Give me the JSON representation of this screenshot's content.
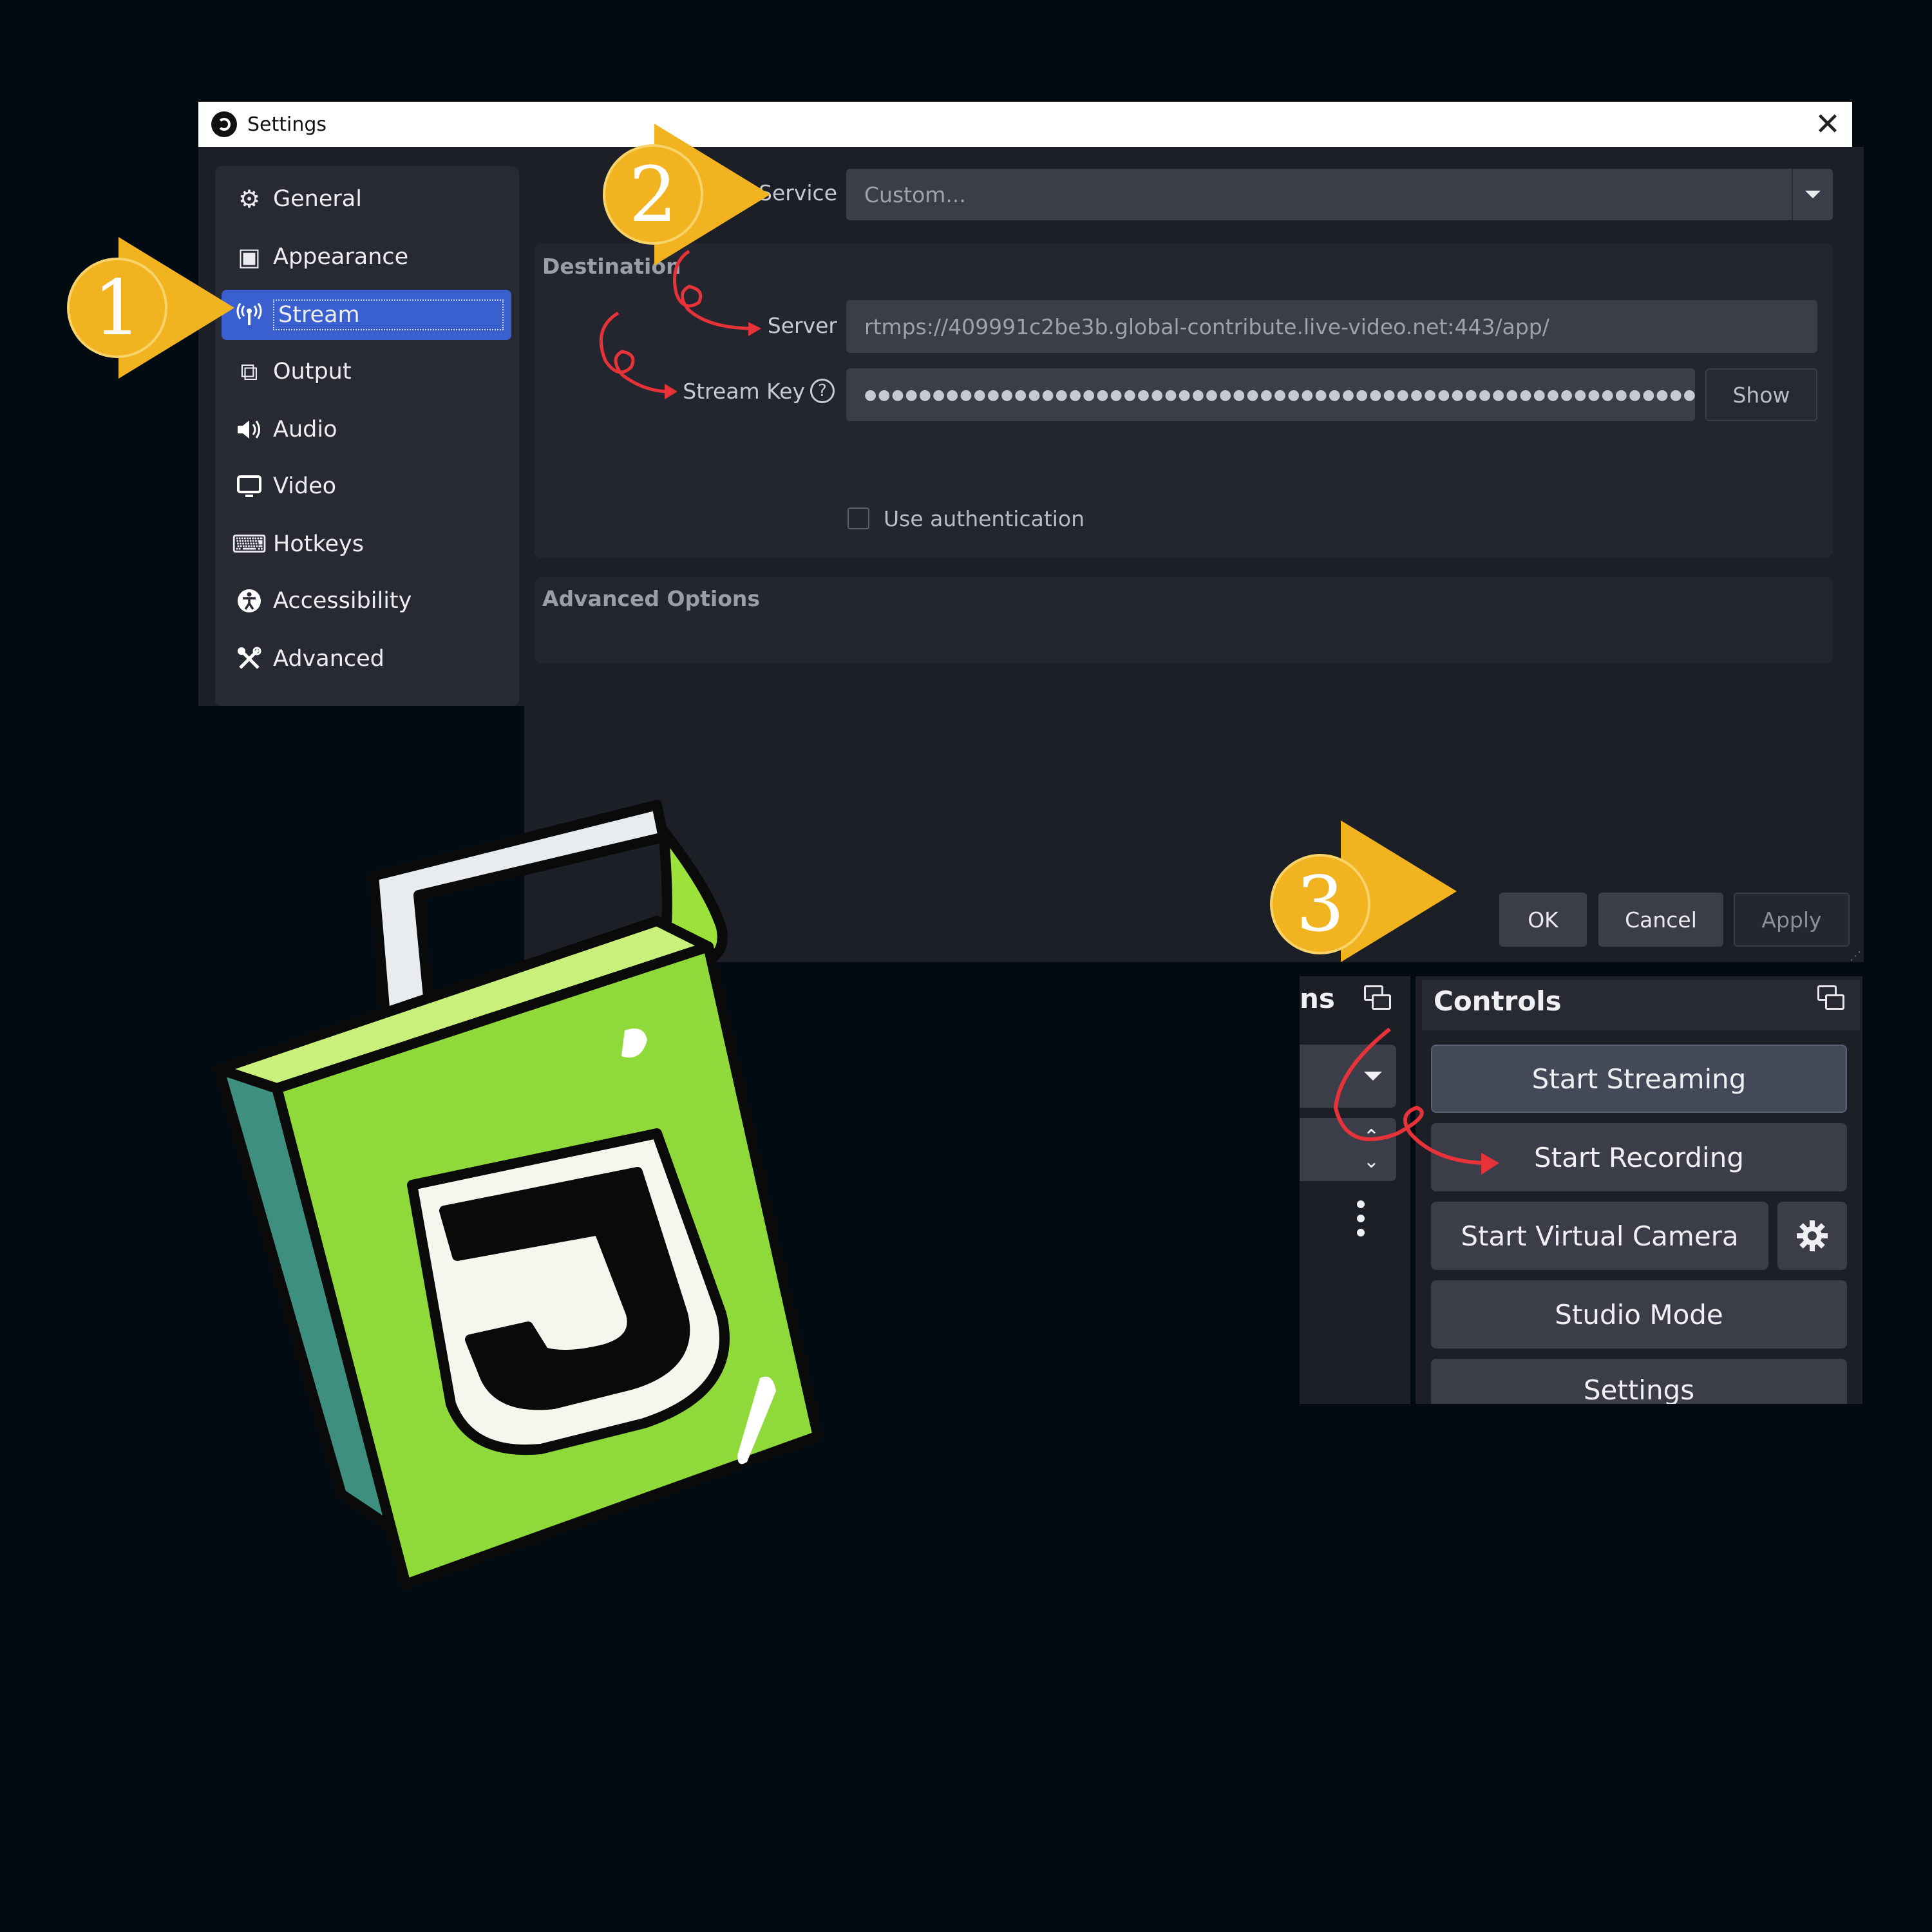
{
  "window": {
    "title": "Settings",
    "close_glyph": "✕"
  },
  "sidebar": {
    "items": [
      {
        "label": "General",
        "icon": "gear-icon",
        "glyph": "⚙"
      },
      {
        "label": "Appearance",
        "icon": "appearance-icon",
        "glyph": "▣"
      },
      {
        "label": "Stream",
        "icon": "antenna-icon",
        "glyph": "ඞ",
        "active": true
      },
      {
        "label": "Output",
        "icon": "output-icon",
        "glyph": "⧉"
      },
      {
        "label": "Audio",
        "icon": "speaker-icon",
        "glyph": "🔉"
      },
      {
        "label": "Video",
        "icon": "monitor-icon",
        "glyph": "▭"
      },
      {
        "label": "Hotkeys",
        "icon": "keyboard-icon",
        "glyph": "⌨"
      },
      {
        "label": "Accessibility",
        "icon": "accessibility-icon",
        "glyph": "♿"
      },
      {
        "label": "Advanced",
        "icon": "tools-icon",
        "glyph": "⚒"
      }
    ]
  },
  "stream": {
    "service_label": "Service",
    "service_value": "Custom...",
    "destination_title": "Destination",
    "server_label": "Server",
    "server_value": "rtmps://409991c2be3b.global-contribute.live-video.net:443/app/",
    "stream_key_label": "Stream Key",
    "stream_key_value": "●●●●●●●●●●●●●●●●●●●●●●●●●●●●●●●●●●●●●●●●●●●●●●●●●●●●●●●●●●●●●●●●",
    "show_label": "Show",
    "use_auth_label": "Use authentication",
    "use_auth_checked": false,
    "advanced_title": "Advanced Options",
    "help_glyph": "?"
  },
  "footer": {
    "ok": "OK",
    "cancel": "Cancel",
    "apply": "Apply"
  },
  "controls": {
    "title": "Controls",
    "partial_title": "ns",
    "buttons": {
      "start_streaming": "Start Streaming",
      "start_recording": "Start Recording",
      "start_virtual_camera": "Start Virtual Camera",
      "studio_mode": "Studio Mode",
      "settings": "Settings"
    }
  },
  "annotations": {
    "step1": "1",
    "step2": "2",
    "step3": "3"
  },
  "colors": {
    "accent": "#3a5fcf",
    "badge": "#f2b320",
    "arrow": "#e8323a",
    "logo_green": "#9be33a"
  }
}
